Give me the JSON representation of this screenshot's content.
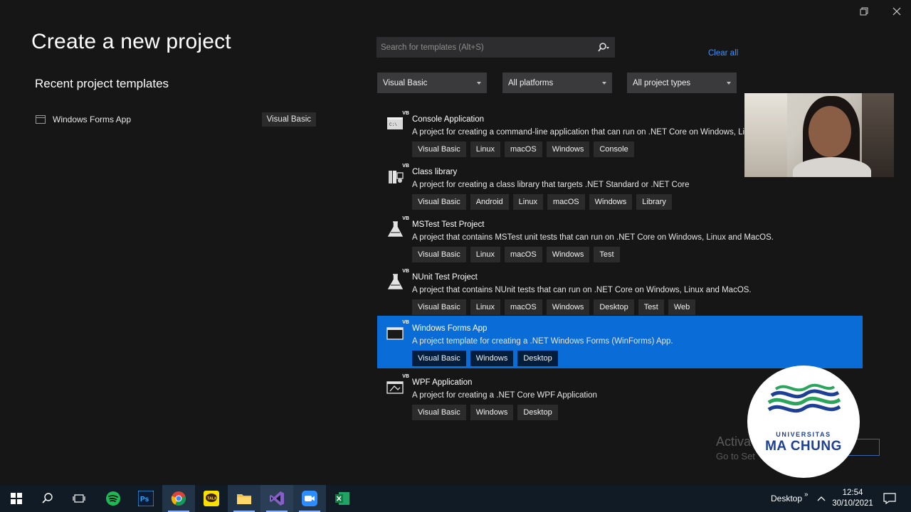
{
  "window": {
    "restore_icon": "restore-icon",
    "close_icon": "close-icon"
  },
  "page": {
    "title": "Create a new project",
    "recent_heading": "Recent project templates",
    "recent_items": [
      {
        "name": "Windows Forms App",
        "language": "Visual Basic"
      }
    ]
  },
  "search": {
    "placeholder": "Search for templates (Alt+S)",
    "clear_all": "Clear all"
  },
  "filters": {
    "language": "Visual Basic",
    "platform": "All platforms",
    "project_type": "All project types"
  },
  "templates": [
    {
      "name": "Console Application",
      "description": "A project for creating a command-line application that can run on .NET Core on Windows, Lin",
      "tags": [
        "Visual Basic",
        "Linux",
        "macOS",
        "Windows",
        "Console"
      ],
      "icon": "console-app-icon",
      "selected": false
    },
    {
      "name": "Class library",
      "description": "A project for creating a class library that targets .NET Standard or .NET Core",
      "tags": [
        "Visual Basic",
        "Android",
        "Linux",
        "macOS",
        "Windows",
        "Library"
      ],
      "icon": "class-library-icon",
      "selected": false
    },
    {
      "name": "MSTest Test Project",
      "description": "A project that contains MSTest unit tests that can run on .NET Core on Windows, Linux and MacOS.",
      "tags": [
        "Visual Basic",
        "Linux",
        "macOS",
        "Windows",
        "Test"
      ],
      "icon": "test-flask-icon",
      "selected": false
    },
    {
      "name": "NUnit Test Project",
      "description": "A project that contains NUnit tests that can run on .NET Core on Windows, Linux and MacOS.",
      "tags": [
        "Visual Basic",
        "Linux",
        "macOS",
        "Windows",
        "Desktop",
        "Test",
        "Web"
      ],
      "icon": "test-flask-icon",
      "selected": false
    },
    {
      "name": "Windows Forms App",
      "description": "A project template for creating a .NET Windows Forms (WinForms) App.",
      "tags": [
        "Visual Basic",
        "Windows",
        "Desktop"
      ],
      "icon": "winforms-icon",
      "selected": true
    },
    {
      "name": "WPF Application",
      "description": "A project for creating a .NET Core WPF Application",
      "tags": [
        "Visual Basic",
        "Windows",
        "Desktop"
      ],
      "icon": "wpf-icon",
      "selected": false
    }
  ],
  "template_badge": "VB",
  "watermark": {
    "line1": "Activa",
    "line2": "Go to Set"
  },
  "logo": {
    "small": "UNIVERSITAS",
    "big": "MA CHUNG"
  },
  "taskbar": {
    "apps": [
      "windows-start-icon",
      "search-icon",
      "task-view-icon",
      "spotify-icon",
      "photoshop-icon",
      "chrome-icon",
      "kakaotalk-icon",
      "file-explorer-icon",
      "visual-studio-icon",
      "zoom-icon",
      "excel-icon"
    ],
    "desktop_label": "Desktop",
    "time": "12:54",
    "date": "30/10/2021"
  },
  "colors": {
    "background": "#161616",
    "selection": "#0a6cd7",
    "link": "#3794ff",
    "taskbar": "#101b26"
  }
}
